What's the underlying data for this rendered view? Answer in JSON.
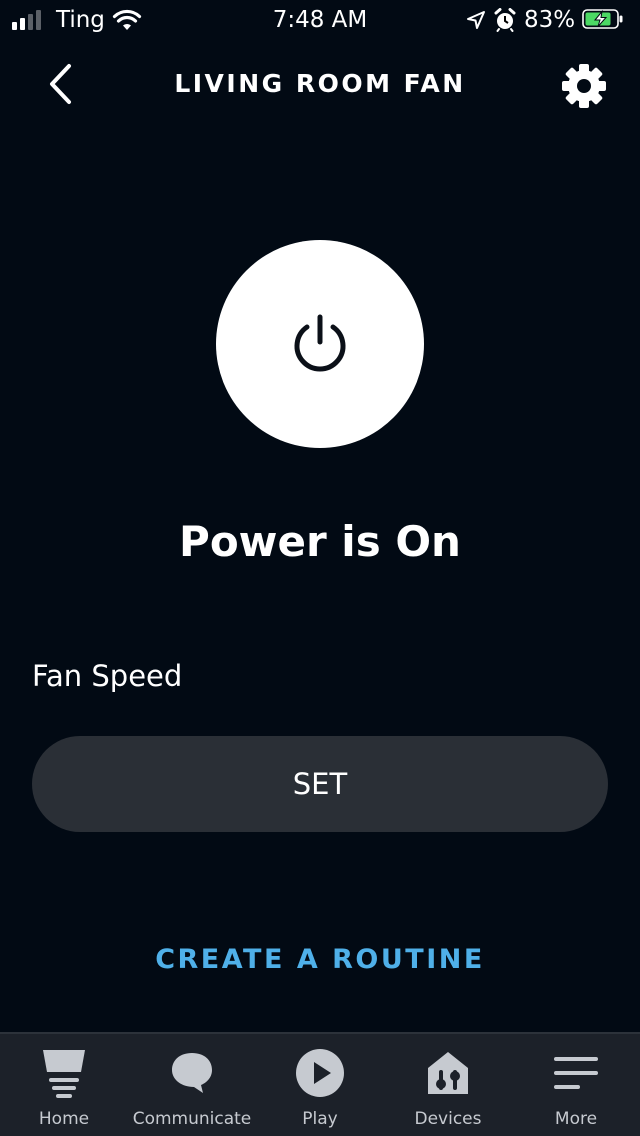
{
  "status_bar": {
    "carrier": "Ting",
    "time": "7:48 AM",
    "battery_percent": "83%",
    "signal_bars": 2,
    "icons": [
      "signal-icon",
      "wifi-icon",
      "location-icon",
      "alarm-icon",
      "battery-charging-icon"
    ]
  },
  "header": {
    "title": "LIVING ROOM FAN",
    "back_icon": "chevron-left-icon",
    "settings_icon": "gear-icon"
  },
  "power": {
    "icon": "power-icon",
    "status": "Power is On"
  },
  "fan_speed": {
    "label": "Fan Speed",
    "button_label": "SET"
  },
  "routine": {
    "link_label": "CREATE A ROUTINE"
  },
  "bottom_nav": {
    "items": [
      {
        "label": "Home",
        "icon": "home-icon"
      },
      {
        "label": "Communicate",
        "icon": "chat-bubble-icon"
      },
      {
        "label": "Play",
        "icon": "play-icon"
      },
      {
        "label": "Devices",
        "icon": "devices-icon"
      },
      {
        "label": "More",
        "icon": "menu-icon"
      }
    ]
  },
  "colors": {
    "background": "#020a14",
    "accent_link": "#4fb0e9",
    "button_bg": "#2a2f36",
    "nav_bg": "#1c2129",
    "battery_green": "#4cd964"
  }
}
